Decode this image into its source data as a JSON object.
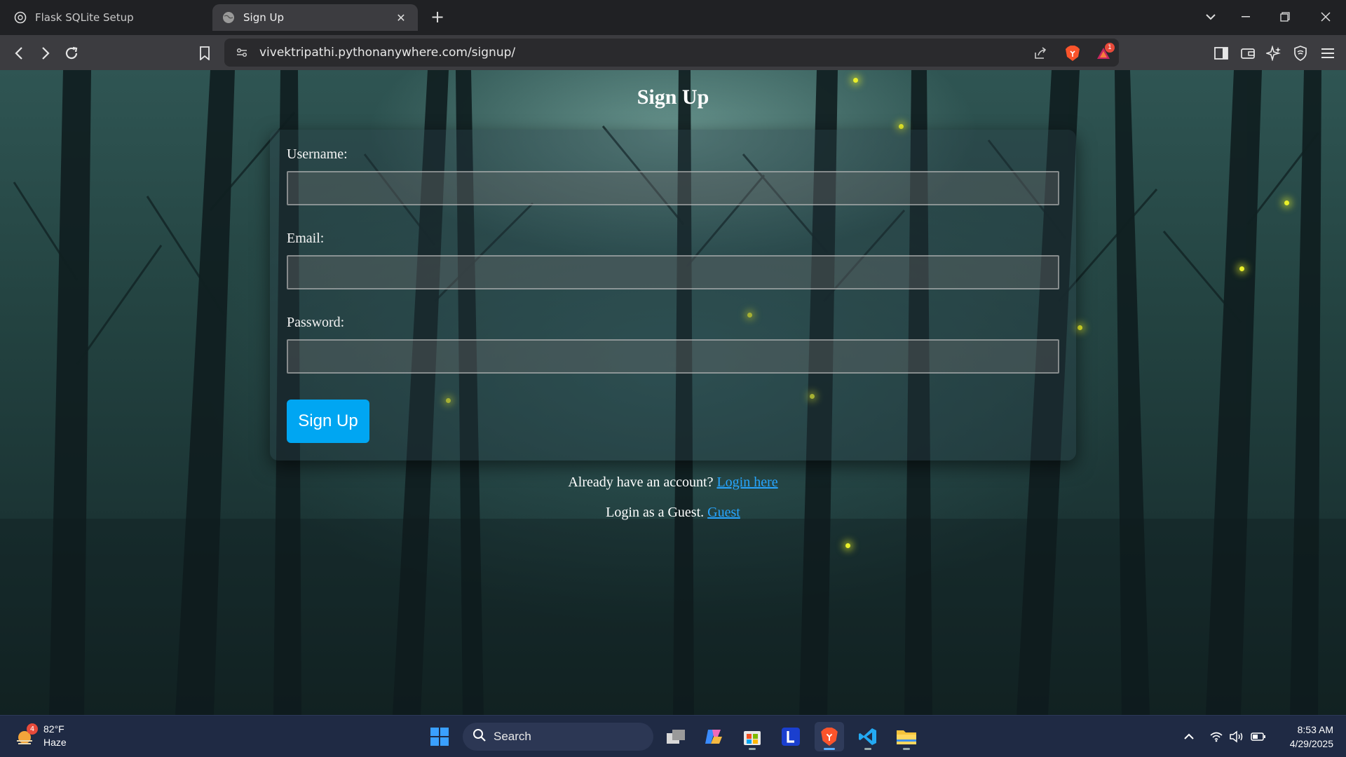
{
  "browser": {
    "tabs": [
      {
        "label": "Flask SQLite Setup",
        "active": false
      },
      {
        "label": "Sign Up",
        "active": true
      }
    ],
    "url": "vivektripathi.pythonanywhere.com/signup/",
    "notification_count": "1"
  },
  "page": {
    "title": "Sign Up",
    "form": {
      "username_label": "Username:",
      "username_value": "",
      "email_label": "Email:",
      "email_value": "",
      "password_label": "Password:",
      "password_value": "",
      "submit_label": "Sign Up"
    },
    "login_prompt": "Already have an account?",
    "login_link": "Login here",
    "guest_prompt": "Login as a Guest.",
    "guest_link": "Guest"
  },
  "taskbar": {
    "weather_temp": "82°F",
    "weather_desc": "Haze",
    "weather_badge": "4",
    "search_label": "Search",
    "time": "8:53 AM",
    "date": "4/29/2025"
  },
  "colors": {
    "accent_button": "#00a6f2",
    "link": "#27a5ff",
    "firefly": "#eaef2a",
    "taskbar": "#1f2a44"
  }
}
